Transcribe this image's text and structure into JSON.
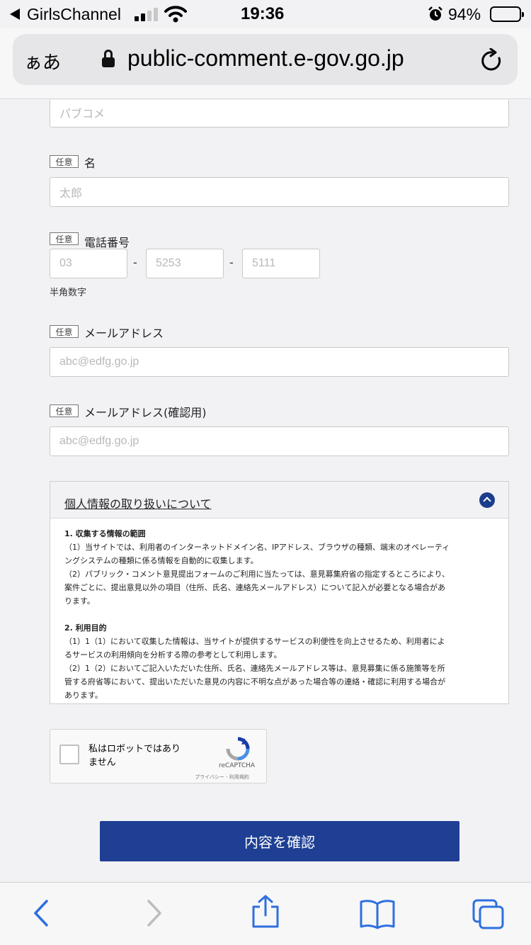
{
  "status_bar": {
    "carrier": "GirlsChannel",
    "time": "19:36",
    "battery_percent": "94%",
    "icons": [
      "back-arrow-icon",
      "signal-icon",
      "wifi-icon",
      "alarm-icon",
      "battery-icon"
    ]
  },
  "browser": {
    "text_size_button": "ぁあ",
    "url": "public-comment.e-gov.go.jp",
    "icons": [
      "lock-icon",
      "reload-icon"
    ]
  },
  "form": {
    "optional_badge": "任意",
    "surname_placeholder": "パブコメ",
    "first_name": {
      "label": "名",
      "placeholder": "太郎"
    },
    "phone": {
      "label": "電話番号",
      "placeholders": [
        "03",
        "5253",
        "5111"
      ],
      "separator": "-",
      "hint": "半角数字"
    },
    "email": {
      "label": "メールアドレス",
      "placeholder": "abc@edfg.go.jp"
    },
    "email_confirm": {
      "label": "メールアドレス(確認用)",
      "placeholder": "abc@edfg.go.jp"
    }
  },
  "privacy": {
    "title": "個人情報の取り扱いについて",
    "sections": [
      {
        "heading": "1. 収集する情報の範囲",
        "lines": [
          "（1）当サイトでは、利用者のインターネットドメイン名、IPアドレス、ブラウザの種類、端末のオペレーティ",
          "ングシステムの種類に係る情報を自動的に収集します。",
          "（2）パブリック・コメント意見提出フォームのご利用に当たっては、意見募集府省の指定するところにより、",
          "案件ごとに、提出意見以外の項目（住所、氏名、連絡先メールアドレス）について記入が必要となる場合があ",
          "ります。"
        ]
      },
      {
        "heading": "2. 利用目的",
        "lines": [
          "（1）1（1）において収集した情報は、当サイトが提供するサービスの利便性を向上させるため、利用者によ",
          "るサービスの利用傾向を分析する際の参考として利用します。",
          "（2）1（2）においてご記入いただいた住所、氏名、連絡先メールアドレス等は、意見募集に係る施策等を所",
          "管する府省等において、提出いただいた意見の内容に不明な点があった場合等の連絡・確認に利用する場合が",
          "あります。"
        ]
      }
    ]
  },
  "recaptcha": {
    "label_line1": "私はロボットではあり",
    "label_line2": "ません",
    "brand": "reCAPTCHA",
    "terms": "プライバシー - 利用規約"
  },
  "submit_label": "内容を確認",
  "toolbar": {
    "icons": [
      "back-icon",
      "forward-icon",
      "share-icon",
      "bookmarks-icon",
      "tabs-icon"
    ]
  },
  "colors": {
    "accent": "#1e3f94",
    "background": "#f2f2f5",
    "input_border": "#c9c9c9"
  }
}
